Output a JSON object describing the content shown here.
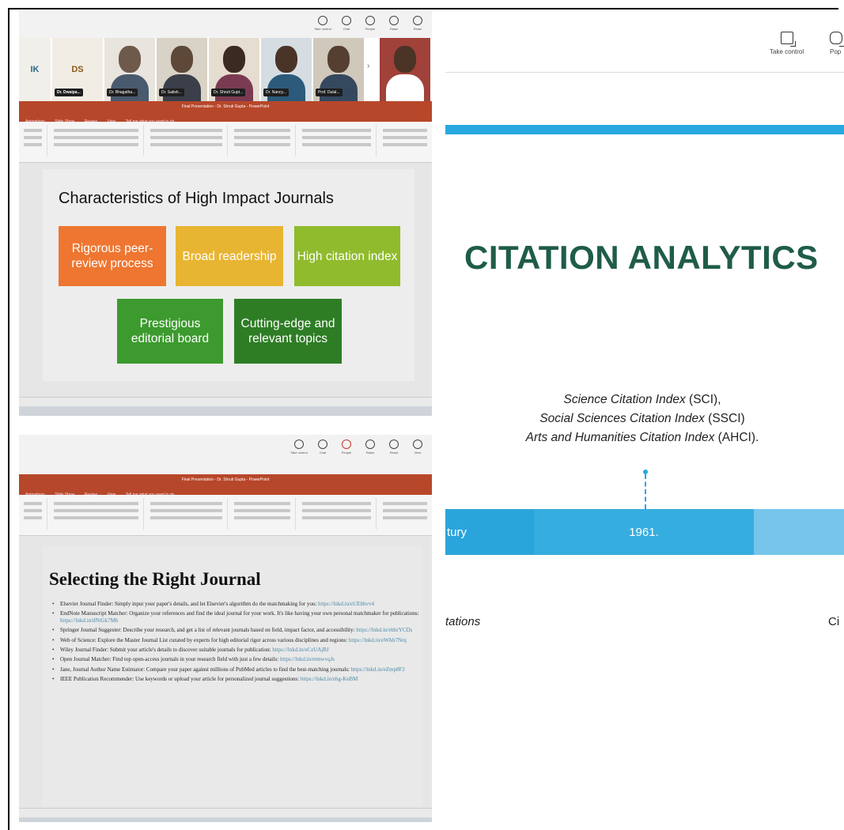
{
  "meeting_controls_small": [
    "Take control",
    "Chat",
    "People",
    "Raise",
    "React",
    "View"
  ],
  "participants": [
    {
      "initials": "IK",
      "name": ""
    },
    {
      "initials": "DS",
      "name": "Dr. Dwaipa..."
    },
    {
      "initials": "",
      "name": "Dr. Bhagatha..."
    },
    {
      "initials": "",
      "name": "Dr. Satish..."
    },
    {
      "initials": "",
      "name": "Dr. Shruti Gupt..."
    },
    {
      "initials": "",
      "name": "Dr. Nancy..."
    },
    {
      "initials": "",
      "name": "Prof. Dulal..."
    }
  ],
  "ppt_window_title": "Final Presentation - Dr. Shruti Gupta - PowerPoint",
  "ppt_menu": [
    "Animations",
    "Slide Show",
    "Review",
    "View",
    "Tell me what you want to do..."
  ],
  "slide1": {
    "title": "Characteristics of High Impact Journals",
    "boxes": [
      {
        "text": "Rigorous peer-review process",
        "color": "#ee7631"
      },
      {
        "text": "Broad readership",
        "color": "#e8b532"
      },
      {
        "text": "High citation index",
        "color": "#8fbb2c"
      },
      {
        "text": "Prestigious editorial board",
        "color": "#3c9a2e"
      },
      {
        "text": "Cutting-edge and relevant topics",
        "color": "#2e7d25"
      }
    ]
  },
  "slide2": {
    "title": "Selecting the Right Journal",
    "items": [
      {
        "text": "Elsevier Journal Finder: Simply input your paper's details, and let Elsevier's algorithm do the matchmaking for you:",
        "link": "https://lnkd.in/eUEbbvv4"
      },
      {
        "text": "EndNote Manuscript Matcher: Organize your references and find the ideal journal for your work. It's like having your own personal matchmaker for publications:",
        "link": "https://lnkd.in/dNtGk7Mh"
      },
      {
        "text": "Springer Journal Suggester: Describe your research, and get a list of relevant journals based on field, impact factor, and accessibility:",
        "link": "https://lnkd.in/ebhrYCDs"
      },
      {
        "text": "Web of Science: Explore the Master Journal List curated by experts for high editorial rigor across various disciplines and regions:",
        "link": "https://lnkd.in/eWAh7Nrq"
      },
      {
        "text": "Wiley Journal Finder: Submit your article's details to discover suitable journals for publication:",
        "link": "https://lnkd.in/eCzUAjBJ"
      },
      {
        "text": "Open Journal Matcher: Find top open-access journals in your research field with just a few details:",
        "link": "https://lnkd.in/etmwvqJs"
      },
      {
        "text": "Jane, Journal Author Name Estimator: Compare your paper against millions of PubMed articles to find the best-matching journals:",
        "link": "https://lnkd.in/eZmp8F2"
      },
      {
        "text": "IEEE Publication Recommender: Use keywords or upload your article for personalized journal suggestions:",
        "link": "https://lnkd.in/ehg-KeBM"
      }
    ]
  },
  "right_panel": {
    "controls": [
      "Take control",
      "Pop"
    ],
    "title": "CITATION ANALYTICS",
    "indexes": [
      {
        "name": "Science Citation Index",
        "abbr": "(SCI),"
      },
      {
        "name": "Social Sciences Citation Index",
        "abbr": "(SSCI)"
      },
      {
        "name": "Arts and Humanities Citation Index",
        "abbr": "(AHCI)."
      }
    ],
    "timeline": [
      "tury",
      "1961.",
      ""
    ],
    "caption_left": "tations",
    "caption_right": "Ci"
  },
  "colors": {
    "ppt_accent": "#b7472a",
    "title_green": "#1f5c4a",
    "timeline_blue": "#29a8e0"
  }
}
